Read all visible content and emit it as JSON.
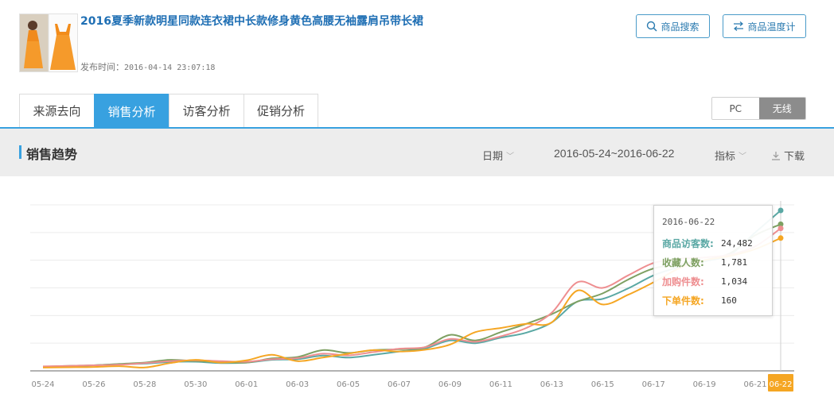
{
  "product": {
    "title": "2016夏季新款明星同款连衣裙中长款修身黄色高腰无袖露肩吊带长裙",
    "publish_label": "发布时间：",
    "publish_time": "2016-04-14 23:07:18"
  },
  "header_buttons": {
    "search": {
      "label": "商品搜索",
      "icon": "search-icon"
    },
    "temperature": {
      "label": "商品温度计",
      "icon": "swap-arrows-icon"
    }
  },
  "tabs": [
    {
      "label": "来源去向",
      "active": false
    },
    {
      "label": "销售分析",
      "active": true
    },
    {
      "label": "访客分析",
      "active": false
    },
    {
      "label": "促销分析",
      "active": false
    }
  ],
  "device_toggle": {
    "pc": "PC",
    "wireless": "无线",
    "selected": "wireless"
  },
  "section": {
    "title": "销售趋势",
    "date_label": "日期",
    "date_range": "2016-05-24~2016-06-22",
    "metric_label": "指标",
    "download_label": "下载"
  },
  "colors": {
    "accent": "#38a1e0",
    "visitors": "#5aa8a4",
    "favorites": "#7ea062",
    "cart": "#ee8e90",
    "orders": "#f5a623"
  },
  "chart_data": {
    "type": "line",
    "x": [
      "05-24",
      "05-25",
      "05-26",
      "05-27",
      "05-28",
      "05-29",
      "05-30",
      "05-31",
      "06-01",
      "06-02",
      "06-03",
      "06-04",
      "06-05",
      "06-06",
      "06-07",
      "06-08",
      "06-09",
      "06-10",
      "06-11",
      "06-12",
      "06-13",
      "06-14",
      "06-15",
      "06-16",
      "06-17",
      "06-18",
      "06-19",
      "06-20",
      "06-21",
      "06-22"
    ],
    "x_tick_labels": [
      "05-24",
      "05-26",
      "05-28",
      "05-30",
      "06-01",
      "06-03",
      "06-05",
      "06-07",
      "06-09",
      "06-11",
      "06-13",
      "06-15",
      "06-17",
      "06-19",
      "06-21",
      "06-22"
    ],
    "ylim": [
      0,
      6
    ],
    "grid": true,
    "series": [
      {
        "name": "商品访客数",
        "color": "#5aa8a4",
        "values": [
          0.15,
          0.17,
          0.2,
          0.24,
          0.26,
          0.32,
          0.33,
          0.28,
          0.3,
          0.4,
          0.42,
          0.55,
          0.48,
          0.58,
          0.7,
          0.8,
          1.1,
          1.0,
          1.2,
          1.38,
          1.75,
          2.5,
          2.6,
          2.98,
          3.45,
          3.75,
          3.96,
          4.2,
          5.0,
          5.8
        ]
      },
      {
        "name": "收藏人数",
        "color": "#7ea062",
        "values": [
          0.15,
          0.18,
          0.2,
          0.25,
          0.3,
          0.4,
          0.35,
          0.32,
          0.3,
          0.45,
          0.5,
          0.75,
          0.65,
          0.75,
          0.78,
          0.85,
          1.3,
          1.1,
          1.4,
          1.7,
          2.05,
          2.5,
          2.8,
          3.3,
          3.7,
          3.85,
          4.0,
          4.25,
          4.9,
          5.3
        ]
      },
      {
        "name": "加购件数",
        "color": "#ee8e90",
        "values": [
          0.16,
          0.18,
          0.2,
          0.22,
          0.28,
          0.35,
          0.38,
          0.35,
          0.33,
          0.42,
          0.46,
          0.62,
          0.56,
          0.68,
          0.8,
          0.85,
          1.15,
          1.05,
          1.25,
          1.55,
          2.1,
          3.2,
          3.0,
          3.45,
          3.9,
          4.05,
          4.1,
          4.2,
          4.5,
          5.15
        ]
      },
      {
        "name": "下单件数",
        "color": "#f5a623",
        "values": [
          0.12,
          0.13,
          0.14,
          0.17,
          0.12,
          0.28,
          0.4,
          0.3,
          0.38,
          0.58,
          0.35,
          0.48,
          0.62,
          0.75,
          0.7,
          0.76,
          0.95,
          1.4,
          1.55,
          1.7,
          1.75,
          2.9,
          2.4,
          2.75,
          3.2,
          3.7,
          4.0,
          4.15,
          4.4,
          4.8
        ]
      }
    ],
    "tooltip": {
      "date": "2016-06-22",
      "rows": [
        {
          "label": "商品访客数",
          "value": "24,482"
        },
        {
          "label": "收藏人数",
          "value": "1,781"
        },
        {
          "label": "加购件数",
          "value": "1,034"
        },
        {
          "label": "下单件数",
          "value": "160"
        }
      ]
    }
  }
}
